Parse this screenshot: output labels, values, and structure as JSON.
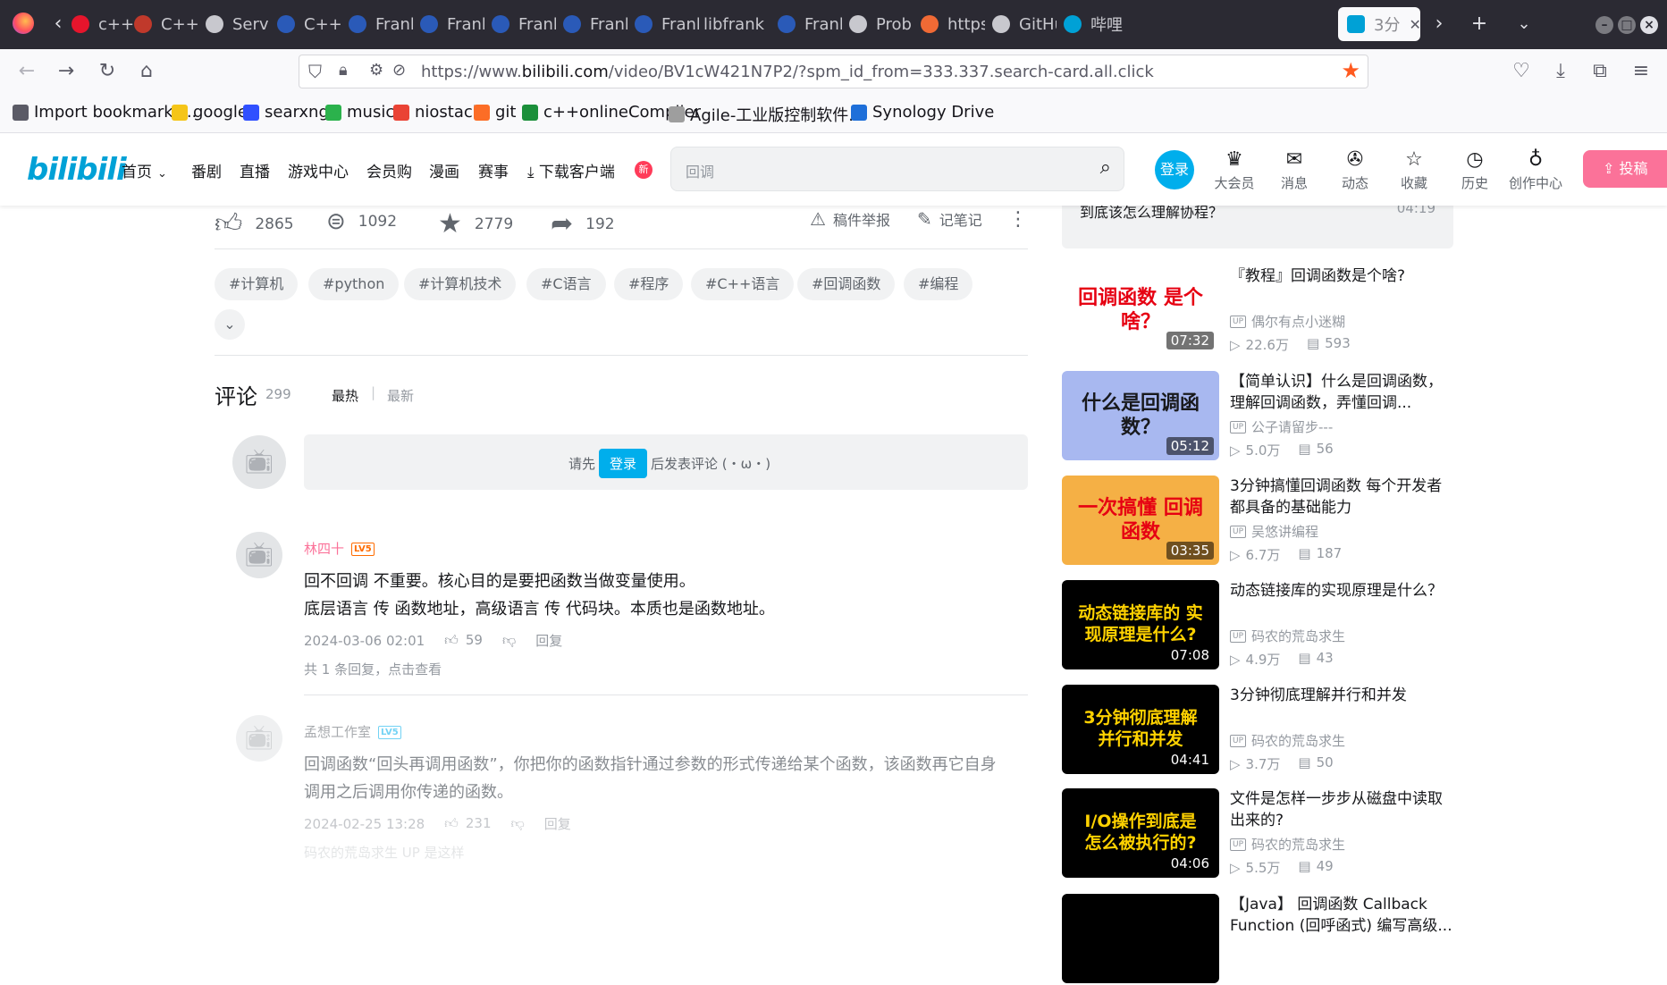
{
  "browser": {
    "tabs": [
      {
        "label": "c++",
        "icon_color": "#e6152c"
      },
      {
        "label": "C++",
        "icon_color": "#c0392b"
      },
      {
        "label": "Serv",
        "icon_color": "#c8c8ce"
      },
      {
        "label": "C++",
        "icon_color": "#2a5ab8"
      },
      {
        "label": "Frank",
        "icon_color": "#2a5ab8"
      },
      {
        "label": "Frank",
        "icon_color": "#2a5ab8"
      },
      {
        "label": "Frank",
        "icon_color": "#2a5ab8"
      },
      {
        "label": "Frank",
        "icon_color": "#2a5ab8"
      },
      {
        "label": "Frank",
        "icon_color": "#2a5ab8"
      },
      {
        "label": "libfrank",
        "icon_color": ""
      },
      {
        "label": "Frank",
        "icon_color": "#2a5ab8"
      },
      {
        "label": "Prob",
        "icon_color": "#c8c8ce"
      },
      {
        "label": "https",
        "icon_color": "#f06a35"
      },
      {
        "label": "GitHu",
        "icon_color": "#c8c8ce"
      },
      {
        "label": "哔哩",
        "icon_color": "#00a1d6"
      }
    ],
    "active_tab": {
      "label": "3分",
      "icon_color": "#00a1d6"
    },
    "url_prefix": "https://www.",
    "url_host": "bilibili.com",
    "url_path": "/video/BV1cW421N7P2/?spm_id_from=333.337.search-card.all.click",
    "bookmarks": [
      {
        "label": "Import bookmarks...",
        "icon_color": "#5b5b66"
      },
      {
        "label": "google",
        "icon_color": "#f5c518"
      },
      {
        "label": "searxng",
        "icon_color": "#3050ff"
      },
      {
        "label": "music",
        "icon_color": "#2bb24c"
      },
      {
        "label": "niostack",
        "icon_color": "#ea4335"
      },
      {
        "label": "git",
        "icon_color": "#fc6d26"
      },
      {
        "label": "c++onlineCompiler",
        "icon_color": "#1b8f3a"
      },
      {
        "label": "Agile-工业版控制软件...",
        "icon_color": "#9e9e9e"
      },
      {
        "label": "Synology Drive",
        "icon_color": "#1e6fd9"
      }
    ]
  },
  "bili": {
    "nav": [
      "首页",
      "番剧",
      "直播",
      "游戏中心",
      "会员购",
      "漫画",
      "赛事"
    ],
    "download": "下载客户端",
    "new_badge": "新",
    "search_placeholder": "回调",
    "login": "登录",
    "header_icons": [
      "大会员",
      "消息",
      "动态",
      "收藏",
      "历史",
      "创作中心"
    ],
    "upload": "投稿"
  },
  "video": {
    "likes": "2865",
    "coins": "1092",
    "favorites": "2779",
    "shares": "192",
    "report": "稿件举报",
    "notes": "记笔记",
    "tags": [
      "#计算机",
      "#python",
      "#计算机技术",
      "#C语言",
      "#程序",
      "#C++语言",
      "#回调函数",
      "#编程"
    ]
  },
  "comments": {
    "title": "评论",
    "count": "299",
    "sort_hot": "最热",
    "sort_new": "最新",
    "prompt_before": "请先",
    "prompt_login": "登录",
    "prompt_after": "后发表评论 (・ω・)",
    "items": [
      {
        "user": "林四十",
        "level": "LV5",
        "lines": [
          "回不回调 不重要。核心目的是要把函数当做变量使用。",
          "底层语言 传 函数地址，高级语言 传 代码块。本质也是函数地址。"
        ],
        "time": "2024-03-06 02:01",
        "likes": "59",
        "reply": "回复",
        "sub": "共 1 条回复，点击查看"
      },
      {
        "user": "孟想工作室",
        "level": "LV5",
        "lines": [
          "回调函数“回头再调用函数”，你把你的函数指针通过参数的形式传递给某个函数，该函数再它自身",
          "调用之后调用你传递的函数。"
        ],
        "time": "2024-02-25 13:28",
        "likes": "231",
        "reply": "回复",
        "sub": "码农的荒岛求生  UP  是这样"
      }
    ]
  },
  "sidebar": {
    "top_title": "到底该怎么理解协程？",
    "top_duration": "04:19",
    "cards": [
      {
        "title": "『教程』回调函数是个啥?",
        "up": "偶尔有点小迷糊",
        "views": "22.6万",
        "danmaku": "593",
        "duration": "07:32",
        "thumb_text": "回调函数 是个啥？",
        "thumb_bg": "#ffffff",
        "thumb_color": "#e60012"
      },
      {
        "title": "【简单认识】什么是回调函数，理解回调函数，弄懂回调...",
        "up": "公子请留步---",
        "views": "5.0万",
        "danmaku": "56",
        "duration": "05:12",
        "thumb_text": "什么是回调函数？",
        "thumb_bg": "#a8b8f0",
        "thumb_color": "#18191c"
      },
      {
        "title": "3分钟搞懂回调函数 每个开发者都具备的基础能力",
        "up": "吴悠讲编程",
        "views": "6.7万",
        "danmaku": "187",
        "duration": "03:35",
        "thumb_text": "一次搞懂 回调函数",
        "thumb_bg": "#f5b045",
        "thumb_color": "#e60012"
      },
      {
        "title": "动态链接库的实现原理是什么？",
        "up": "码农的荒岛求生",
        "views": "4.9万",
        "danmaku": "43",
        "duration": "07:08",
        "thumb_text": "动态链接库的 实现原理是什么?",
        "thumb_bg": "#000000",
        "thumb_color": "#ffd200"
      },
      {
        "title": "3分钟彻底理解并行和并发",
        "up": "码农的荒岛求生",
        "views": "3.7万",
        "danmaku": "50",
        "duration": "04:41",
        "thumb_text": "3分钟彻底理解 并行和并发",
        "thumb_bg": "#000000",
        "thumb_color": "#ffd200"
      },
      {
        "title": "文件是怎样一步步从磁盘中读取出来的?",
        "up": "码农的荒岛求生",
        "views": "5.5万",
        "danmaku": "49",
        "duration": "04:06",
        "thumb_text": "I/O操作到底是 怎么被执行的?",
        "thumb_bg": "#000000",
        "thumb_color": "#ffd200"
      },
      {
        "title": "【Java】 回调函数 Callback Function (回呼函式) 编写高级...",
        "up": "",
        "views": "",
        "danmaku": "",
        "duration": "",
        "thumb_text": "",
        "thumb_bg": "#000000",
        "thumb_color": "#ffffff"
      }
    ]
  }
}
